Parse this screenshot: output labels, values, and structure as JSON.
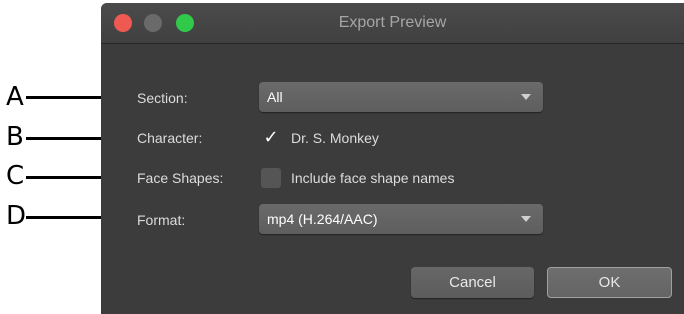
{
  "window": {
    "title": "Export Preview"
  },
  "callouts": [
    "A",
    "B",
    "C",
    "D"
  ],
  "form": {
    "section": {
      "label": "Section:",
      "value": "All"
    },
    "character": {
      "label": "Character:",
      "checked": true,
      "option_label": "Dr. S. Monkey"
    },
    "face_shapes": {
      "label": "Face Shapes:",
      "checked": false,
      "option_label": "Include face shape names"
    },
    "format": {
      "label": "Format:",
      "value": "mp4 (H.264/AAC)"
    }
  },
  "buttons": {
    "cancel": "Cancel",
    "ok": "OK"
  },
  "icons": {
    "close": "close-traffic-light",
    "minimize": "minimize-traffic-light",
    "zoom": "zoom-traffic-light",
    "popup_arrow": "chevron-down-icon",
    "check": "checkmark-icon"
  }
}
